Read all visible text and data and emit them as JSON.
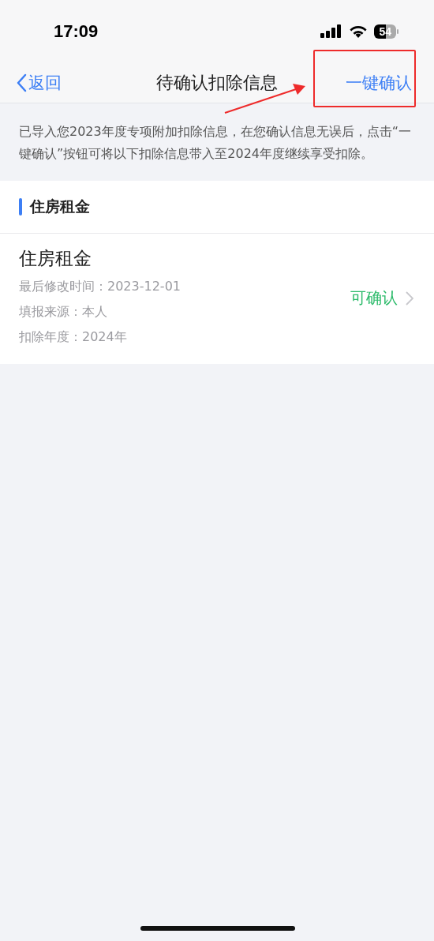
{
  "status_bar": {
    "time": "17:09",
    "battery": "54"
  },
  "nav": {
    "back": "返回",
    "title": "待确认扣除信息",
    "action": "一键确认"
  },
  "notice": "已导入您2023年度专项附加扣除信息，在您确认信息无误后，点击“一键确认”按钮可将以下扣除信息带入至2024年度继续享受扣除。",
  "sections": [
    {
      "title": "住房租金",
      "items": [
        {
          "title": "住房租金",
          "details": [
            "最后修改时间：2023-12-01",
            "填报来源：本人",
            "扣除年度：2024年"
          ],
          "status": "可确认"
        }
      ]
    }
  ]
}
